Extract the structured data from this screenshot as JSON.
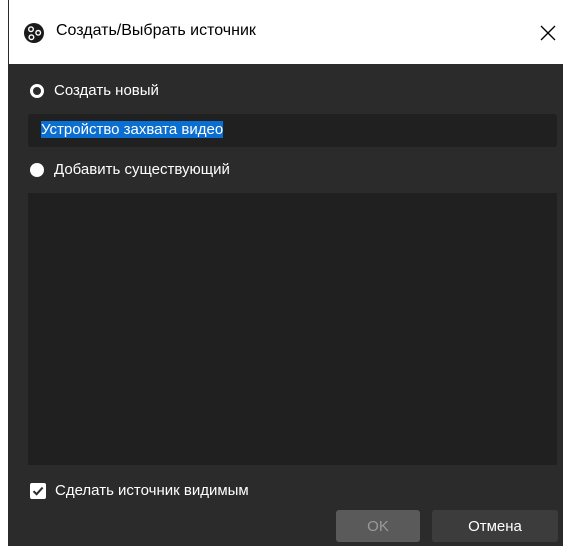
{
  "window": {
    "title": "Создать/Выбрать источник",
    "title_icon": "obs-logo-icon",
    "close_icon": "close-icon"
  },
  "options": {
    "create_new": {
      "label": "Создать новый",
      "checked": true
    },
    "name_input": {
      "value": "Устройство захвата видео"
    },
    "add_existing": {
      "label": "Добавить существующий",
      "checked": false
    },
    "existing_sources": []
  },
  "visibility": {
    "label": "Сделать источник видимым",
    "checked": true
  },
  "buttons": {
    "ok_label": "OK",
    "cancel_label": "Отмена"
  },
  "colors": {
    "background": "#2b2b2b",
    "field": "#202020",
    "selection": "#0a6fd1",
    "ok_disabled": "#5a5a5a",
    "cancel": "#3c3c3c"
  }
}
